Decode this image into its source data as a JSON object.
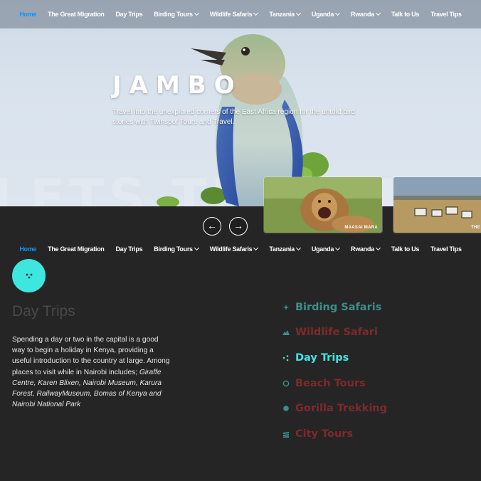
{
  "nav": {
    "items": [
      {
        "label": "Home",
        "active": true,
        "dropdown": false
      },
      {
        "label": "The Great Migration",
        "active": false,
        "dropdown": false
      },
      {
        "label": "Day Trips",
        "active": false,
        "dropdown": false
      },
      {
        "label": "Birding Tours",
        "active": false,
        "dropdown": true
      },
      {
        "label": "Wildlife Safaris",
        "active": false,
        "dropdown": true
      },
      {
        "label": "Tanzania",
        "active": false,
        "dropdown": true
      },
      {
        "label": "Uganda",
        "active": false,
        "dropdown": true
      },
      {
        "label": "Rwanda",
        "active": false,
        "dropdown": true
      },
      {
        "label": "Talk to Us",
        "active": false,
        "dropdown": false
      },
      {
        "label": "Travel Tips",
        "active": false,
        "dropdown": false
      }
    ]
  },
  "hero": {
    "title": "JAMBO",
    "subtitle": "Travel into the unexplored corners of the East Africa region for the untold bird stories with Twinspot Tours and Travel.",
    "background_text": "LETS TRAVEL"
  },
  "slider": {
    "prev_icon": "←",
    "next_icon": "→",
    "cards": [
      {
        "label": "MAASAI MARA"
      },
      {
        "label": "THE"
      }
    ]
  },
  "section": {
    "title": "Day Trips",
    "body_text": "Spending a day or two in the capital is a good way to begin a holiday in Kenya, providing a useful introduction to the country at large. Among places to visit while in Nairobi includes;",
    "body_places": "Giraffe Centre, Karen Blixen, Nairobi Museum, Karura Forest, RailwayMuseum, Bomas of Kenya and Nairobi National Park"
  },
  "categories": [
    {
      "label": "Birding Safaris",
      "color": "#3a8f8c",
      "icon": "bird-icon"
    },
    {
      "label": "Wildlife Safari",
      "color": "#7e2a2a",
      "icon": "mountain-icon"
    },
    {
      "label": "Day Trips",
      "color": "#3ee6e0",
      "icon": "dots-icon"
    },
    {
      "label": "Beach Tours",
      "color": "#7e2a2a",
      "icon": "circle-outline-icon"
    },
    {
      "label": "Gorilla Trekking",
      "color": "#7e2a2a",
      "icon": "circle-filled-icon"
    },
    {
      "label": "City Tours",
      "color": "#7e2a2a",
      "icon": "buildings-icon"
    }
  ],
  "colors": {
    "accent": "#3ee6e0",
    "nav_active": "#1e8ee0",
    "background": "#262526",
    "icon_teal": "#3a8f8c"
  }
}
